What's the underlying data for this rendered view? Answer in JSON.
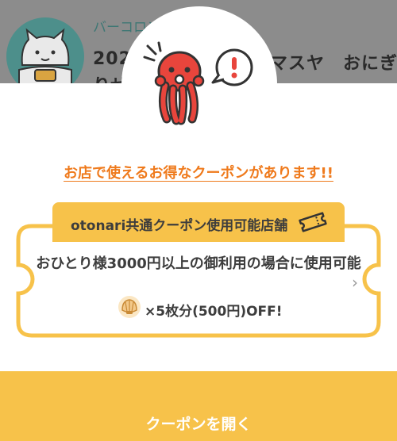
{
  "background": {
    "shop_name": "バーコロン",
    "title_start": "202",
    "title_end": "マスヤ　おにぎ",
    "title_line2": "りせ"
  },
  "modal": {
    "headline": "お店で使えるお得なクーポンがあります!!",
    "coupon": {
      "tab_label": "otonari共通クーポン使用可能店舗",
      "condition": "おひとり様3000円以上の御利用の場合に使用可能",
      "offer": "×5枚分(500円)OFF!"
    },
    "open_button_label": "クーポンを開く"
  },
  "colors": {
    "accent_orange": "#ef7a1c",
    "coupon_yellow": "#f7c24a",
    "mascot_red": "#e8453c"
  }
}
